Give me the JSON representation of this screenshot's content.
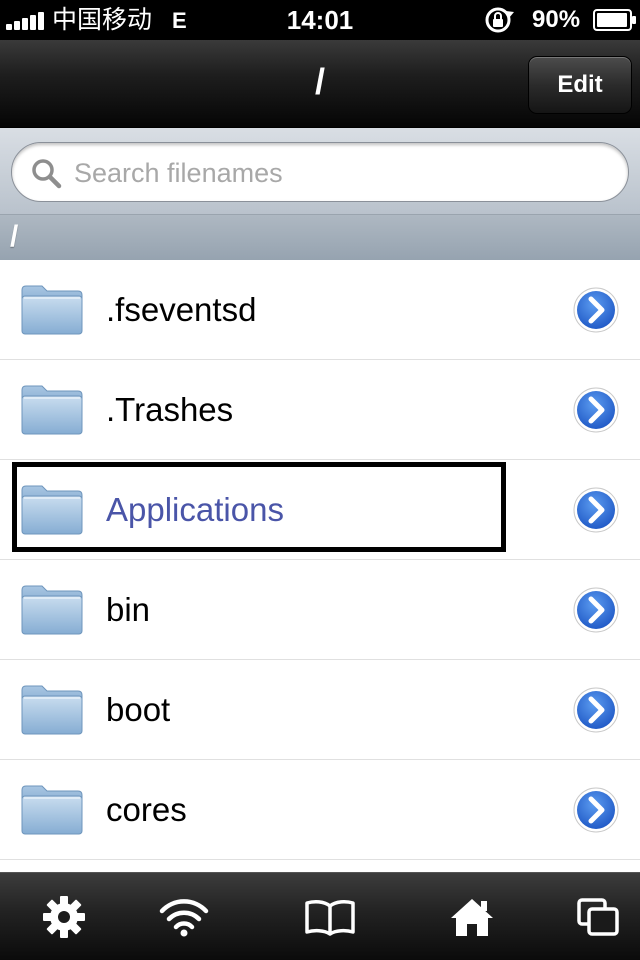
{
  "status_bar": {
    "carrier": "中国移动",
    "network": "E",
    "time": "14:01",
    "battery_percent": "90%",
    "icons": [
      "signal-bars-icon",
      "rotation-lock-icon",
      "battery-icon"
    ]
  },
  "nav_bar": {
    "title": "/",
    "edit_label": "Edit"
  },
  "search": {
    "placeholder": "Search filenames",
    "value": ""
  },
  "path": {
    "current": "/"
  },
  "files": [
    {
      "name": ".fseventsd",
      "type": "folder",
      "selected": false
    },
    {
      "name": ".Trashes",
      "type": "folder",
      "selected": false
    },
    {
      "name": "Applications",
      "type": "folder",
      "selected": true
    },
    {
      "name": "bin",
      "type": "folder",
      "selected": false
    },
    {
      "name": "boot",
      "type": "folder",
      "selected": false
    },
    {
      "name": "cores",
      "type": "folder",
      "selected": false
    }
  ],
  "tab_bar": {
    "tabs": [
      {
        "icon": "gear-icon"
      },
      {
        "icon": "wifi-icon"
      },
      {
        "icon": "book-icon"
      },
      {
        "icon": "home-icon"
      },
      {
        "icon": "windows-icon"
      }
    ]
  },
  "colors": {
    "selected_text": "#4a55a8",
    "detail_button": "#2b6fd6"
  }
}
